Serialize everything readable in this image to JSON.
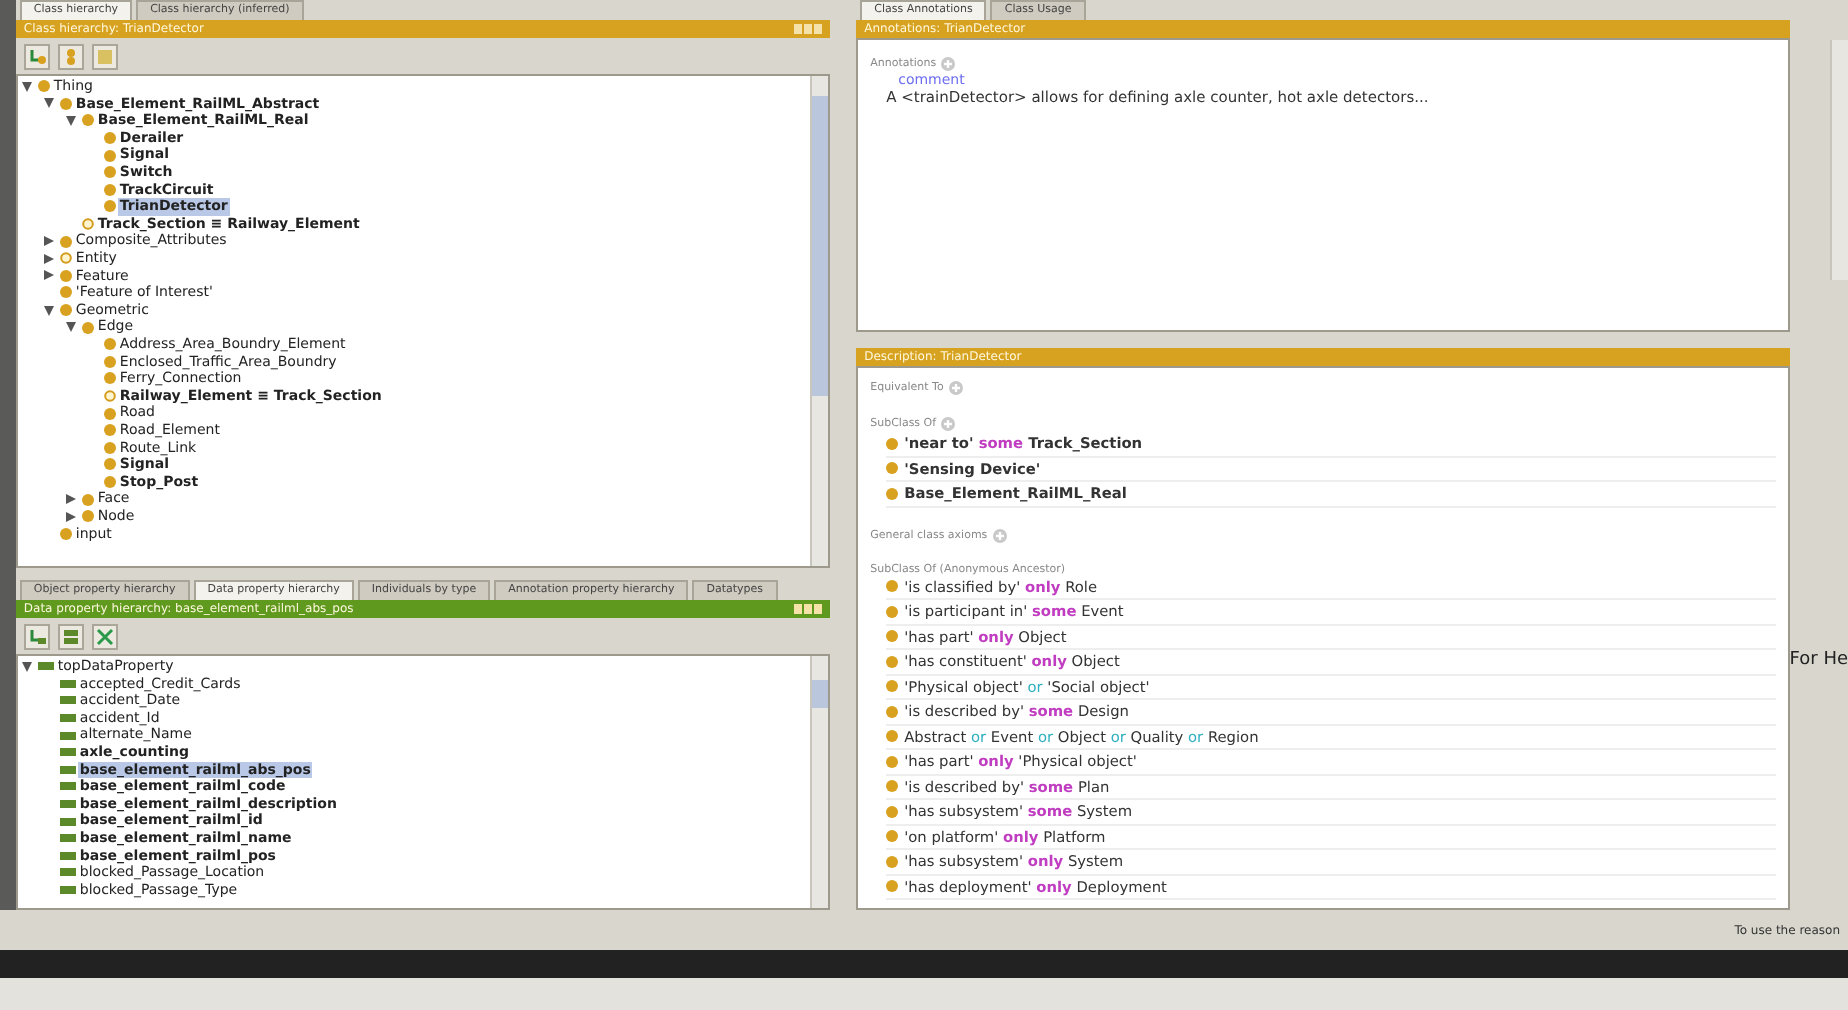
{
  "class_hierarchy": {
    "tabs": [
      {
        "label": "Class hierarchy",
        "selected": true
      },
      {
        "label": "Class hierarchy (inferred)",
        "selected": false
      }
    ],
    "title": "Class hierarchy: TrianDetector",
    "tree": [
      {
        "label": "Thing",
        "kind": "class",
        "bold": false,
        "selected": false,
        "expanded": true,
        "children": [
          {
            "label": "Base_Element_RailML_Abstract",
            "kind": "class",
            "bold": true,
            "selected": false,
            "expanded": true,
            "children": [
              {
                "label": "Base_Element_RailML_Real",
                "kind": "class",
                "bold": true,
                "selected": false,
                "expanded": true,
                "children": [
                  {
                    "label": "Derailer",
                    "kind": "class",
                    "bold": true,
                    "selected": false
                  },
                  {
                    "label": "Signal",
                    "kind": "class",
                    "bold": true,
                    "selected": false
                  },
                  {
                    "label": "Switch",
                    "kind": "class",
                    "bold": true,
                    "selected": false
                  },
                  {
                    "label": "TrackCircuit",
                    "kind": "class",
                    "bold": true,
                    "selected": false
                  },
                  {
                    "label": "TrianDetector",
                    "kind": "class",
                    "bold": true,
                    "selected": true
                  }
                ]
              },
              {
                "label": "Track_Section ≡ Railway_Element",
                "kind": "defined",
                "bold": true,
                "selected": false
              }
            ]
          },
          {
            "label": "Composite_Attributes",
            "kind": "class",
            "bold": false,
            "selected": false,
            "expanded": false
          },
          {
            "label": "Entity",
            "kind": "defined",
            "bold": false,
            "selected": false,
            "expanded": false
          },
          {
            "label": "Feature",
            "kind": "class",
            "bold": false,
            "selected": false,
            "expanded": false
          },
          {
            "label": "'Feature of Interest'",
            "kind": "class",
            "bold": false,
            "selected": false
          },
          {
            "label": "Geometric",
            "kind": "class",
            "bold": false,
            "selected": false,
            "expanded": true,
            "children": [
              {
                "label": "Edge",
                "kind": "class",
                "bold": false,
                "selected": false,
                "expanded": true,
                "children": [
                  {
                    "label": "Address_Area_Boundry_Element",
                    "kind": "class",
                    "bold": false,
                    "selected": false
                  },
                  {
                    "label": "Enclosed_Traffic_Area_Boundry",
                    "kind": "class",
                    "bold": false,
                    "selected": false
                  },
                  {
                    "label": "Ferry_Connection",
                    "kind": "class",
                    "bold": false,
                    "selected": false
                  },
                  {
                    "label": "Railway_Element ≡ Track_Section",
                    "kind": "defined",
                    "bold": true,
                    "selected": false
                  },
                  {
                    "label": "Road",
                    "kind": "class",
                    "bold": false,
                    "selected": false
                  },
                  {
                    "label": "Road_Element",
                    "kind": "class",
                    "bold": false,
                    "selected": false
                  },
                  {
                    "label": "Route_Link",
                    "kind": "class",
                    "bold": false,
                    "selected": false
                  },
                  {
                    "label": "Signal",
                    "kind": "class",
                    "bold": true,
                    "selected": false
                  },
                  {
                    "label": "Stop_Post",
                    "kind": "class",
                    "bold": true,
                    "selected": false
                  }
                ]
              },
              {
                "label": "Face",
                "kind": "class",
                "bold": false,
                "selected": false,
                "expanded": false
              },
              {
                "label": "Node",
                "kind": "class",
                "bold": false,
                "selected": false,
                "expanded": false
              }
            ]
          },
          {
            "label": "input",
            "kind": "class",
            "bold": false,
            "selected": false
          }
        ]
      }
    ]
  },
  "property_hierarchy": {
    "tabs": [
      {
        "label": "Object property hierarchy",
        "selected": false
      },
      {
        "label": "Data property hierarchy",
        "selected": true
      },
      {
        "label": "Individuals by type",
        "selected": false
      },
      {
        "label": "Annotation property hierarchy",
        "selected": false
      },
      {
        "label": "Datatypes",
        "selected": false
      }
    ],
    "title": "Data property hierarchy: base_element_railml_abs_pos",
    "tree": [
      {
        "label": "topDataProperty",
        "kind": "property",
        "bold": false,
        "selected": false,
        "expanded": true,
        "children": [
          {
            "label": "accepted_Credit_Cards",
            "kind": "property",
            "bold": false,
            "selected": false
          },
          {
            "label": "accident_Date",
            "kind": "property",
            "bold": false,
            "selected": false
          },
          {
            "label": "accident_Id",
            "kind": "property",
            "bold": false,
            "selected": false
          },
          {
            "label": "alternate_Name",
            "kind": "property",
            "bold": false,
            "selected": false
          },
          {
            "label": "axle_counting",
            "kind": "property",
            "bold": true,
            "selected": false
          },
          {
            "label": "base_element_railml_abs_pos",
            "kind": "property",
            "bold": true,
            "selected": true
          },
          {
            "label": "base_element_railml_code",
            "kind": "property",
            "bold": true,
            "selected": false
          },
          {
            "label": "base_element_railml_description",
            "kind": "property",
            "bold": true,
            "selected": false
          },
          {
            "label": "base_element_railml_id",
            "kind": "property",
            "bold": true,
            "selected": false
          },
          {
            "label": "base_element_railml_name",
            "kind": "property",
            "bold": true,
            "selected": false
          },
          {
            "label": "base_element_railml_pos",
            "kind": "property",
            "bold": true,
            "selected": false
          },
          {
            "label": "blocked_Passage_Location",
            "kind": "property",
            "bold": false,
            "selected": false
          },
          {
            "label": "blocked_Passage_Type",
            "kind": "property",
            "bold": false,
            "selected": false
          }
        ]
      }
    ]
  },
  "annotations": {
    "tabs": [
      {
        "label": "Class Annotations",
        "selected": true
      },
      {
        "label": "Class Usage",
        "selected": false
      }
    ],
    "title": "Annotations: TrianDetector",
    "section": "Annotations",
    "items": [
      {
        "property": "comment",
        "value": "A <trainDetector> allows for defining axle counter, hot axle detectors..."
      }
    ]
  },
  "side_label": "For He",
  "description": {
    "title": "Description: TrianDetector",
    "sections": [
      {
        "label": "Equivalent To"
      },
      {
        "label": "SubClass Of",
        "axioms": [
          [
            {
              "text": "'near to'",
              "kind": "entity"
            },
            {
              "text": "some",
              "kind": "quantifier"
            },
            {
              "text": "Track_Section",
              "kind": "entity"
            }
          ],
          [
            {
              "text": "'Sensing Device'",
              "kind": "entity"
            }
          ],
          [
            {
              "text": "Base_Element_RailML_Real",
              "kind": "entity"
            }
          ]
        ],
        "bold": true
      },
      {
        "label": "General class axioms"
      },
      {
        "label": "SubClass Of (Anonymous Ancestor)",
        "bold": false,
        "axioms": [
          [
            {
              "text": "'is classified by'",
              "kind": "entity"
            },
            {
              "text": "only",
              "kind": "quantifier"
            },
            {
              "text": "Role",
              "kind": "entity"
            }
          ],
          [
            {
              "text": "'is participant in'",
              "kind": "entity"
            },
            {
              "text": "some",
              "kind": "quantifier"
            },
            {
              "text": "Event",
              "kind": "entity"
            }
          ],
          [
            {
              "text": "'has part'",
              "kind": "entity"
            },
            {
              "text": "only",
              "kind": "quantifier"
            },
            {
              "text": "Object",
              "kind": "entity"
            }
          ],
          [
            {
              "text": "'has constituent'",
              "kind": "entity"
            },
            {
              "text": "only",
              "kind": "quantifier"
            },
            {
              "text": "Object",
              "kind": "entity"
            }
          ],
          [
            {
              "text": "'Physical object'",
              "kind": "entity"
            },
            {
              "text": "or",
              "kind": "connective"
            },
            {
              "text": "'Social object'",
              "kind": "entity"
            }
          ],
          [
            {
              "text": "'is described by'",
              "kind": "entity"
            },
            {
              "text": "some",
              "kind": "quantifier"
            },
            {
              "text": "Design",
              "kind": "entity"
            }
          ],
          [
            {
              "text": "Abstract",
              "kind": "entity"
            },
            {
              "text": "or",
              "kind": "connective"
            },
            {
              "text": "Event",
              "kind": "entity"
            },
            {
              "text": "or",
              "kind": "connective"
            },
            {
              "text": "Object",
              "kind": "entity"
            },
            {
              "text": "or",
              "kind": "connective"
            },
            {
              "text": "Quality",
              "kind": "entity"
            },
            {
              "text": "or",
              "kind": "connective"
            },
            {
              "text": "Region",
              "kind": "entity"
            }
          ],
          [
            {
              "text": "'has part'",
              "kind": "entity"
            },
            {
              "text": "only",
              "kind": "quantifier"
            },
            {
              "text": "'Physical object'",
              "kind": "entity"
            }
          ],
          [
            {
              "text": "'is described by'",
              "kind": "entity"
            },
            {
              "text": "some",
              "kind": "quantifier"
            },
            {
              "text": "Plan",
              "kind": "entity"
            }
          ],
          [
            {
              "text": "'has subsystem'",
              "kind": "entity"
            },
            {
              "text": "some",
              "kind": "quantifier"
            },
            {
              "text": "System",
              "kind": "entity"
            }
          ],
          [
            {
              "text": "'on platform'",
              "kind": "entity"
            },
            {
              "text": "only",
              "kind": "quantifier"
            },
            {
              "text": "Platform",
              "kind": "entity"
            }
          ],
          [
            {
              "text": "'has subsystem'",
              "kind": "entity"
            },
            {
              "text": "only",
              "kind": "quantifier"
            },
            {
              "text": "System",
              "kind": "entity"
            }
          ],
          [
            {
              "text": "'has deployment'",
              "kind": "entity"
            },
            {
              "text": "only",
              "kind": "quantifier"
            },
            {
              "text": "Deployment",
              "kind": "entity"
            }
          ]
        ]
      }
    ]
  },
  "status_bar": "To use the reason"
}
